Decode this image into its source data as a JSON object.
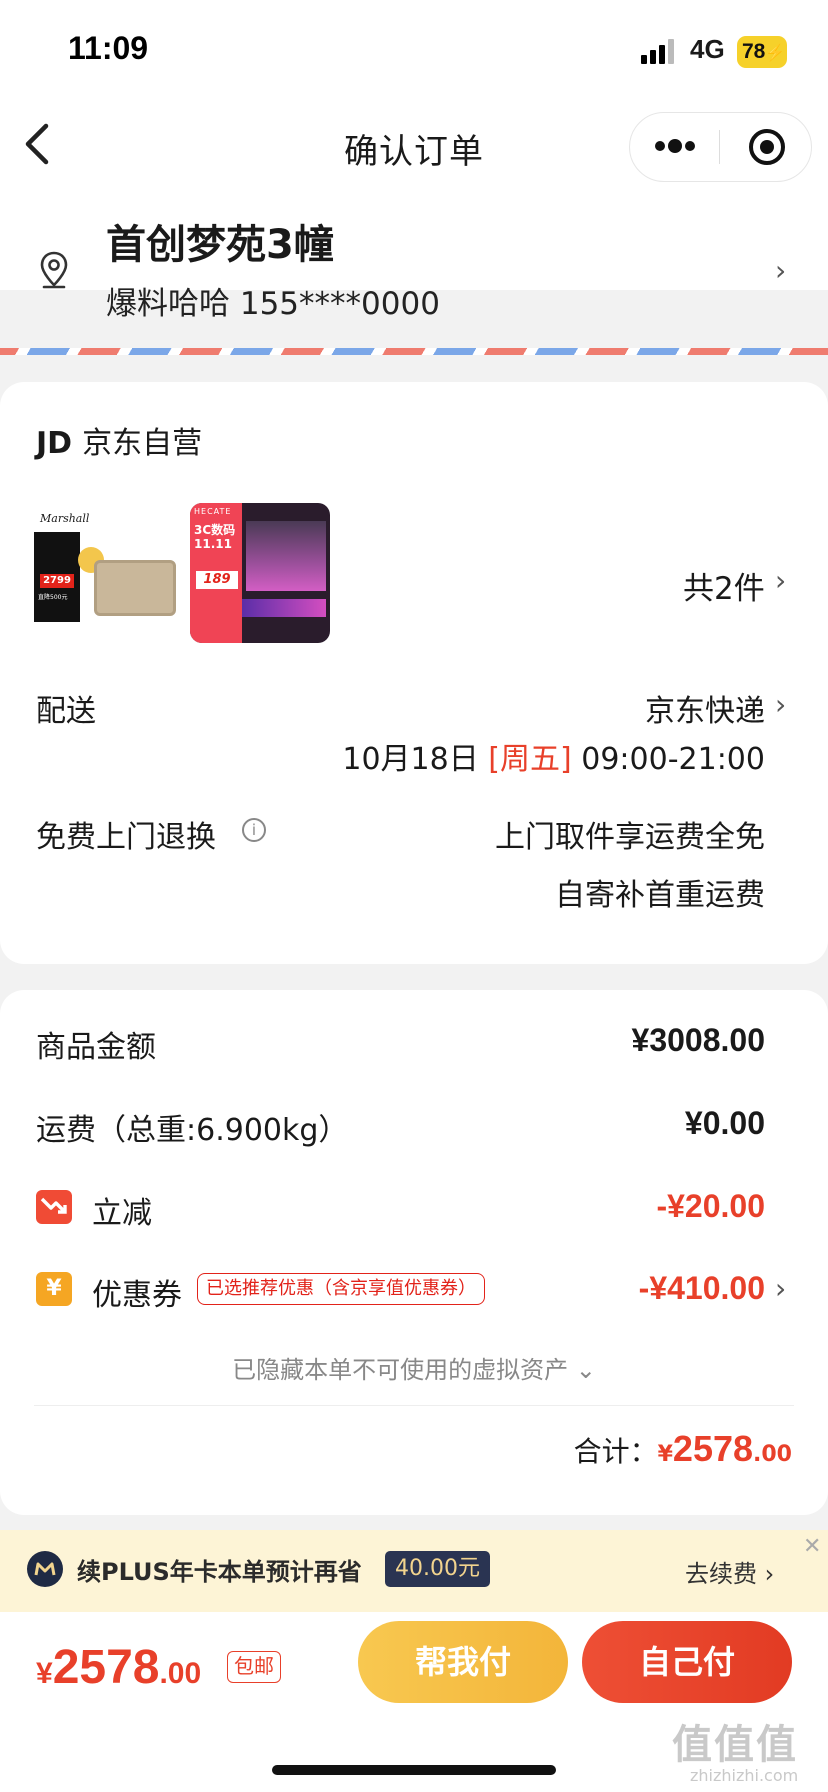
{
  "status_bar": {
    "time": "11:09",
    "network": "4G",
    "battery": "78"
  },
  "header": {
    "title": "确认订单",
    "back_icon": "chevron-left-icon",
    "menu_icon": "more-dots-icon",
    "close_icon": "target-icon"
  },
  "address": {
    "title": "首创梦苑3幢",
    "contact": "爆料哈哈 155****0000"
  },
  "shop": {
    "logo": "JD",
    "name": "京东自营",
    "item_count": "共2件"
  },
  "products": [
    {
      "brand": "Marshall",
      "price": "2799",
      "tag": "直降500元"
    },
    {
      "brand": "HECATE",
      "label": "3C数码 11.11",
      "price": "189"
    }
  ],
  "delivery": {
    "label": "配送",
    "method": "京东快递",
    "date": "10月18日",
    "weekday": "[周五]",
    "time_range": "09:00-21:00"
  },
  "returns": {
    "label": "免费上门退换",
    "line1": "上门取件享运费全免",
    "line2": "自寄补首重运费"
  },
  "prices": {
    "goods_label": "商品金额",
    "goods_value": "¥3008.00",
    "shipping_label": "运费（总重:6.900kg）",
    "shipping_value": "¥0.00",
    "instant_label": "立减",
    "instant_value": "-¥20.00",
    "coupon_label": "优惠券",
    "coupon_tag": "已选推荐优惠（含京享值优惠券）",
    "coupon_value": "-¥410.00",
    "hidden_tip": "已隐藏本单不可使用的虚拟资产",
    "total_label": "合计：",
    "total_symbol": "¥",
    "total_int": "2578",
    "total_dec": ".00"
  },
  "plus_banner": {
    "text": "续PLUS年卡本单预计再省",
    "amount": "40.00元",
    "action": "去续费"
  },
  "bottom_bar": {
    "symbol": "¥",
    "price_int": "2578",
    "price_dec": ".00",
    "shipping_tag": "包邮",
    "help_pay": "帮我付",
    "self_pay": "自己付"
  },
  "watermark": {
    "main": "值值值",
    "sub": "zhizhizhi.com"
  },
  "colors": {
    "accent_red": "#e2231a",
    "help_btn": "#f7c244",
    "pay_btn": "#e8402a"
  }
}
